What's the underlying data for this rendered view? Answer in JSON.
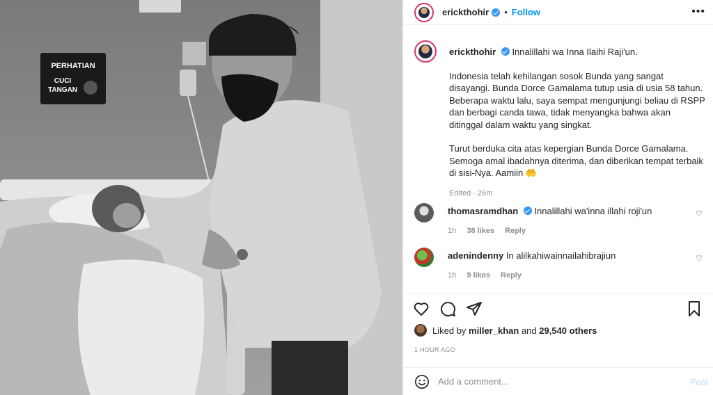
{
  "header": {
    "username": "erickthohir",
    "separator": "•",
    "follow_label": "Follow",
    "more_label": "•••"
  },
  "caption": {
    "username": "erickthohir",
    "line1": "Innalillahi wa Inna Ilaihi Raji'un.",
    "para2": "Indonesia telah kehilangan sosok Bunda yang sangat disayangi. Bunda Dorce Gamalama tutup usia di usia 58 tahun. Beberapa waktu lalu, saya sempat mengunjungi beliau di RSPP dan berbagi canda tawa, tidak menyangka bahwa akan ditinggal dalam waktu yang singkat.",
    "para3": "Turut berduka cita atas kepergian Bunda Dorce Gamalama. Semoga amal ibadahnya diterima, dan diberikan tempat terbaik di sisi-Nya. Aamiin 🤲",
    "edited": "Edited · 26m"
  },
  "comments": [
    {
      "username": "thomasramdhan",
      "text": "Innalillahi wa'inna illahi roji'un",
      "time": "1h",
      "likes": "38 likes",
      "reply": "Reply"
    },
    {
      "username": "adenindenny",
      "text": "In alilkahiwainnailahibrajiun",
      "time": "1h",
      "likes": "9 likes",
      "reply": "Reply"
    }
  ],
  "likes": {
    "prefix": "Liked by",
    "user": "miller_khan",
    "and": "and",
    "count": "29,540 others"
  },
  "time_ago": "1 HOUR AGO",
  "add_comment": {
    "placeholder": "Add a comment...",
    "post_label": "Post"
  },
  "image": {
    "sign_title": "PERHATIAN",
    "sign_line1": "CUCI",
    "sign_line2": "TANGAN"
  },
  "colors": {
    "accent": "#0095f6",
    "verified": "#3897f0",
    "muted": "#8e8e8e"
  },
  "icons": [
    "heart-icon",
    "comment-icon",
    "share-icon",
    "bookmark-icon",
    "emoji-icon",
    "verified-icon",
    "more-icon"
  ]
}
